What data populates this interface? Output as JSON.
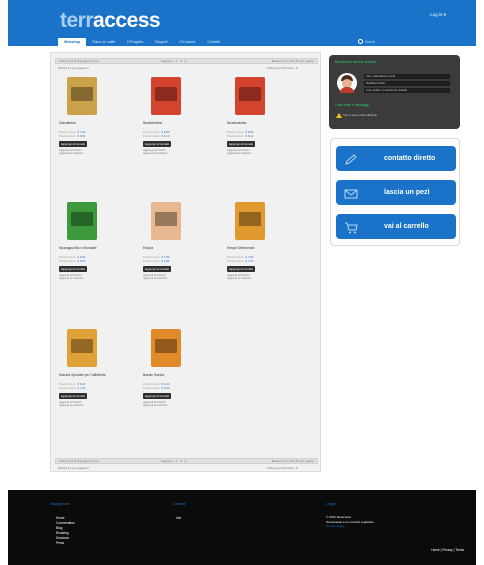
{
  "header": {
    "logo_prefix": "terr",
    "logo_suffix": "access",
    "login": "Log in ▾",
    "search_placeholder": "Search ...",
    "nav": [
      "Webshop",
      "Piano un caffè",
      "Il Progetto",
      "Blogroll",
      "Chi siamo",
      "Contatti"
    ]
  },
  "shop": {
    "top_bar": {
      "left": "Articoli 1-8 di 8 (pagina 1 di 1)",
      "pages": "Pagina 1 · 2 · 3 · 4",
      "per_page": "Mostra 12 ▾  | 24 | 48 per pagina"
    },
    "sub_bar": {
      "left": "Mostra 12 per pagina  ▾",
      "sort": "Ordina per  Posizione  ⇅"
    },
    "bottom_bar": {
      "left": "Articoli 1-8 di 8 (pagina 1 di 1)",
      "pages": "Pagina 1 · 2 · 3 · 4",
      "per_page": "Mostra 12 ▾  | 24 | 48 per pagina"
    },
    "bottom_sub": {
      "left": "Mostra 12 per pagina  ▾",
      "sort": "Ordina per  Posizione  ⇅"
    },
    "products": [
      {
        "name": "Gianalbertó",
        "price_old": "Prezzo intero",
        "price": "€ 7,20",
        "price2": "€ 6,50",
        "button": "Aggiungi al Carrello",
        "link1": "Aggiungi ai Preferiti",
        "link2": "Aggiungi al confronto",
        "color": "#c9a24a"
      },
      {
        "name": "Nicaforbalino",
        "price_old": "Prezzo intero",
        "price": "€ 6,80",
        "price2": "€ 6,10",
        "button": "Aggiungi al Carrello",
        "link1": "Aggiungi ai Preferiti",
        "link2": "Aggiungi al confronto",
        "color": "#d4432e"
      },
      {
        "name": "Nicaforabista",
        "price_old": "Prezzo intero",
        "price": "€ 6,80",
        "price2": "€ 6,10",
        "button": "Aggiungi al Carrello",
        "link1": "Aggiungi ai Preferiti",
        "link2": "Aggiungi al confronto",
        "color": "#d4432e"
      },
      {
        "name": "Nicaragua Bio e Mondiale",
        "price_old": "Prezzo intero",
        "price": "€ 6,90",
        "price2": "€ 6,20",
        "button": "Aggiungi al Carrello",
        "link1": "Aggiungi ai Preferiti",
        "link2": "Aggiungi al confronto",
        "color": "#3c9a3c"
      },
      {
        "name": "Etiopia",
        "price_old": "Prezzo intero",
        "price": "€ 7,50",
        "price2": "€ 6,90",
        "button": "Aggiungi al Carrello",
        "link1": "Aggiungi ai Preferiti",
        "link2": "Aggiungi al confronto",
        "color": "#e8b890"
      },
      {
        "name": "Kenya Selezionato",
        "price_old": "Prezzo intero",
        "price": "€ 7,80",
        "price2": "€ 7,10",
        "button": "Aggiungi al Carrello",
        "link1": "Aggiungi ai Preferiti",
        "link2": "Aggiungi al confronto",
        "color": "#e09a30"
      },
      {
        "name": "Miscela Speciale per Caffetteria",
        "price_old": "Prezzo intero",
        "price": "€ 8,20",
        "price2": "€ 7,40",
        "button": "Aggiungi al Carrello",
        "link1": "Aggiungi ai Preferiti",
        "link2": "Aggiungi al confronto",
        "color": "#e0a238"
      },
      {
        "name": "Brasile Santos",
        "price_old": "Prezzo intero",
        "price": "€ 6,40",
        "price2": "€ 5,90",
        "button": "Aggiungi al Carrello",
        "link1": "Aggiungi ai Preferiti",
        "link2": "Aggiungi al confronto",
        "color": "#e08a2a"
      }
    ]
  },
  "account": {
    "title": "Benvenuto nel tuo account",
    "rows": [
      "Ciao, Gianalberto Verdi",
      "Modifica Profilo",
      "Il tuo ordine: 0 articoli nel carrello"
    ],
    "subtitle": "I tuoi ordini e messaggi",
    "warning": "Non ci sono ordini effettuati"
  },
  "actions": {
    "contact": "contatto diretto",
    "leave": "lascia un pezì",
    "cart": "vai al carrello"
  },
  "footer": {
    "col1_title": "Navigazione",
    "col1_items": [
      "Home",
      "Conversation",
      "Blog",
      "Roasting",
      "Sessions",
      "Press"
    ],
    "col2_title": "Contatti",
    "col2_items": [
      "Info"
    ],
    "col3_title": "Legali",
    "copyright_1": "© 2013 Terraccess",
    "copyright_2": "Terraccesso è un marchio registrato",
    "privacy": "Privacy policy",
    "legal_links": "Home | Privacy | Terms"
  },
  "colors": {
    "header": "#1a73c9",
    "footer": "#0b0b0b",
    "accent": "#2ecc71"
  }
}
